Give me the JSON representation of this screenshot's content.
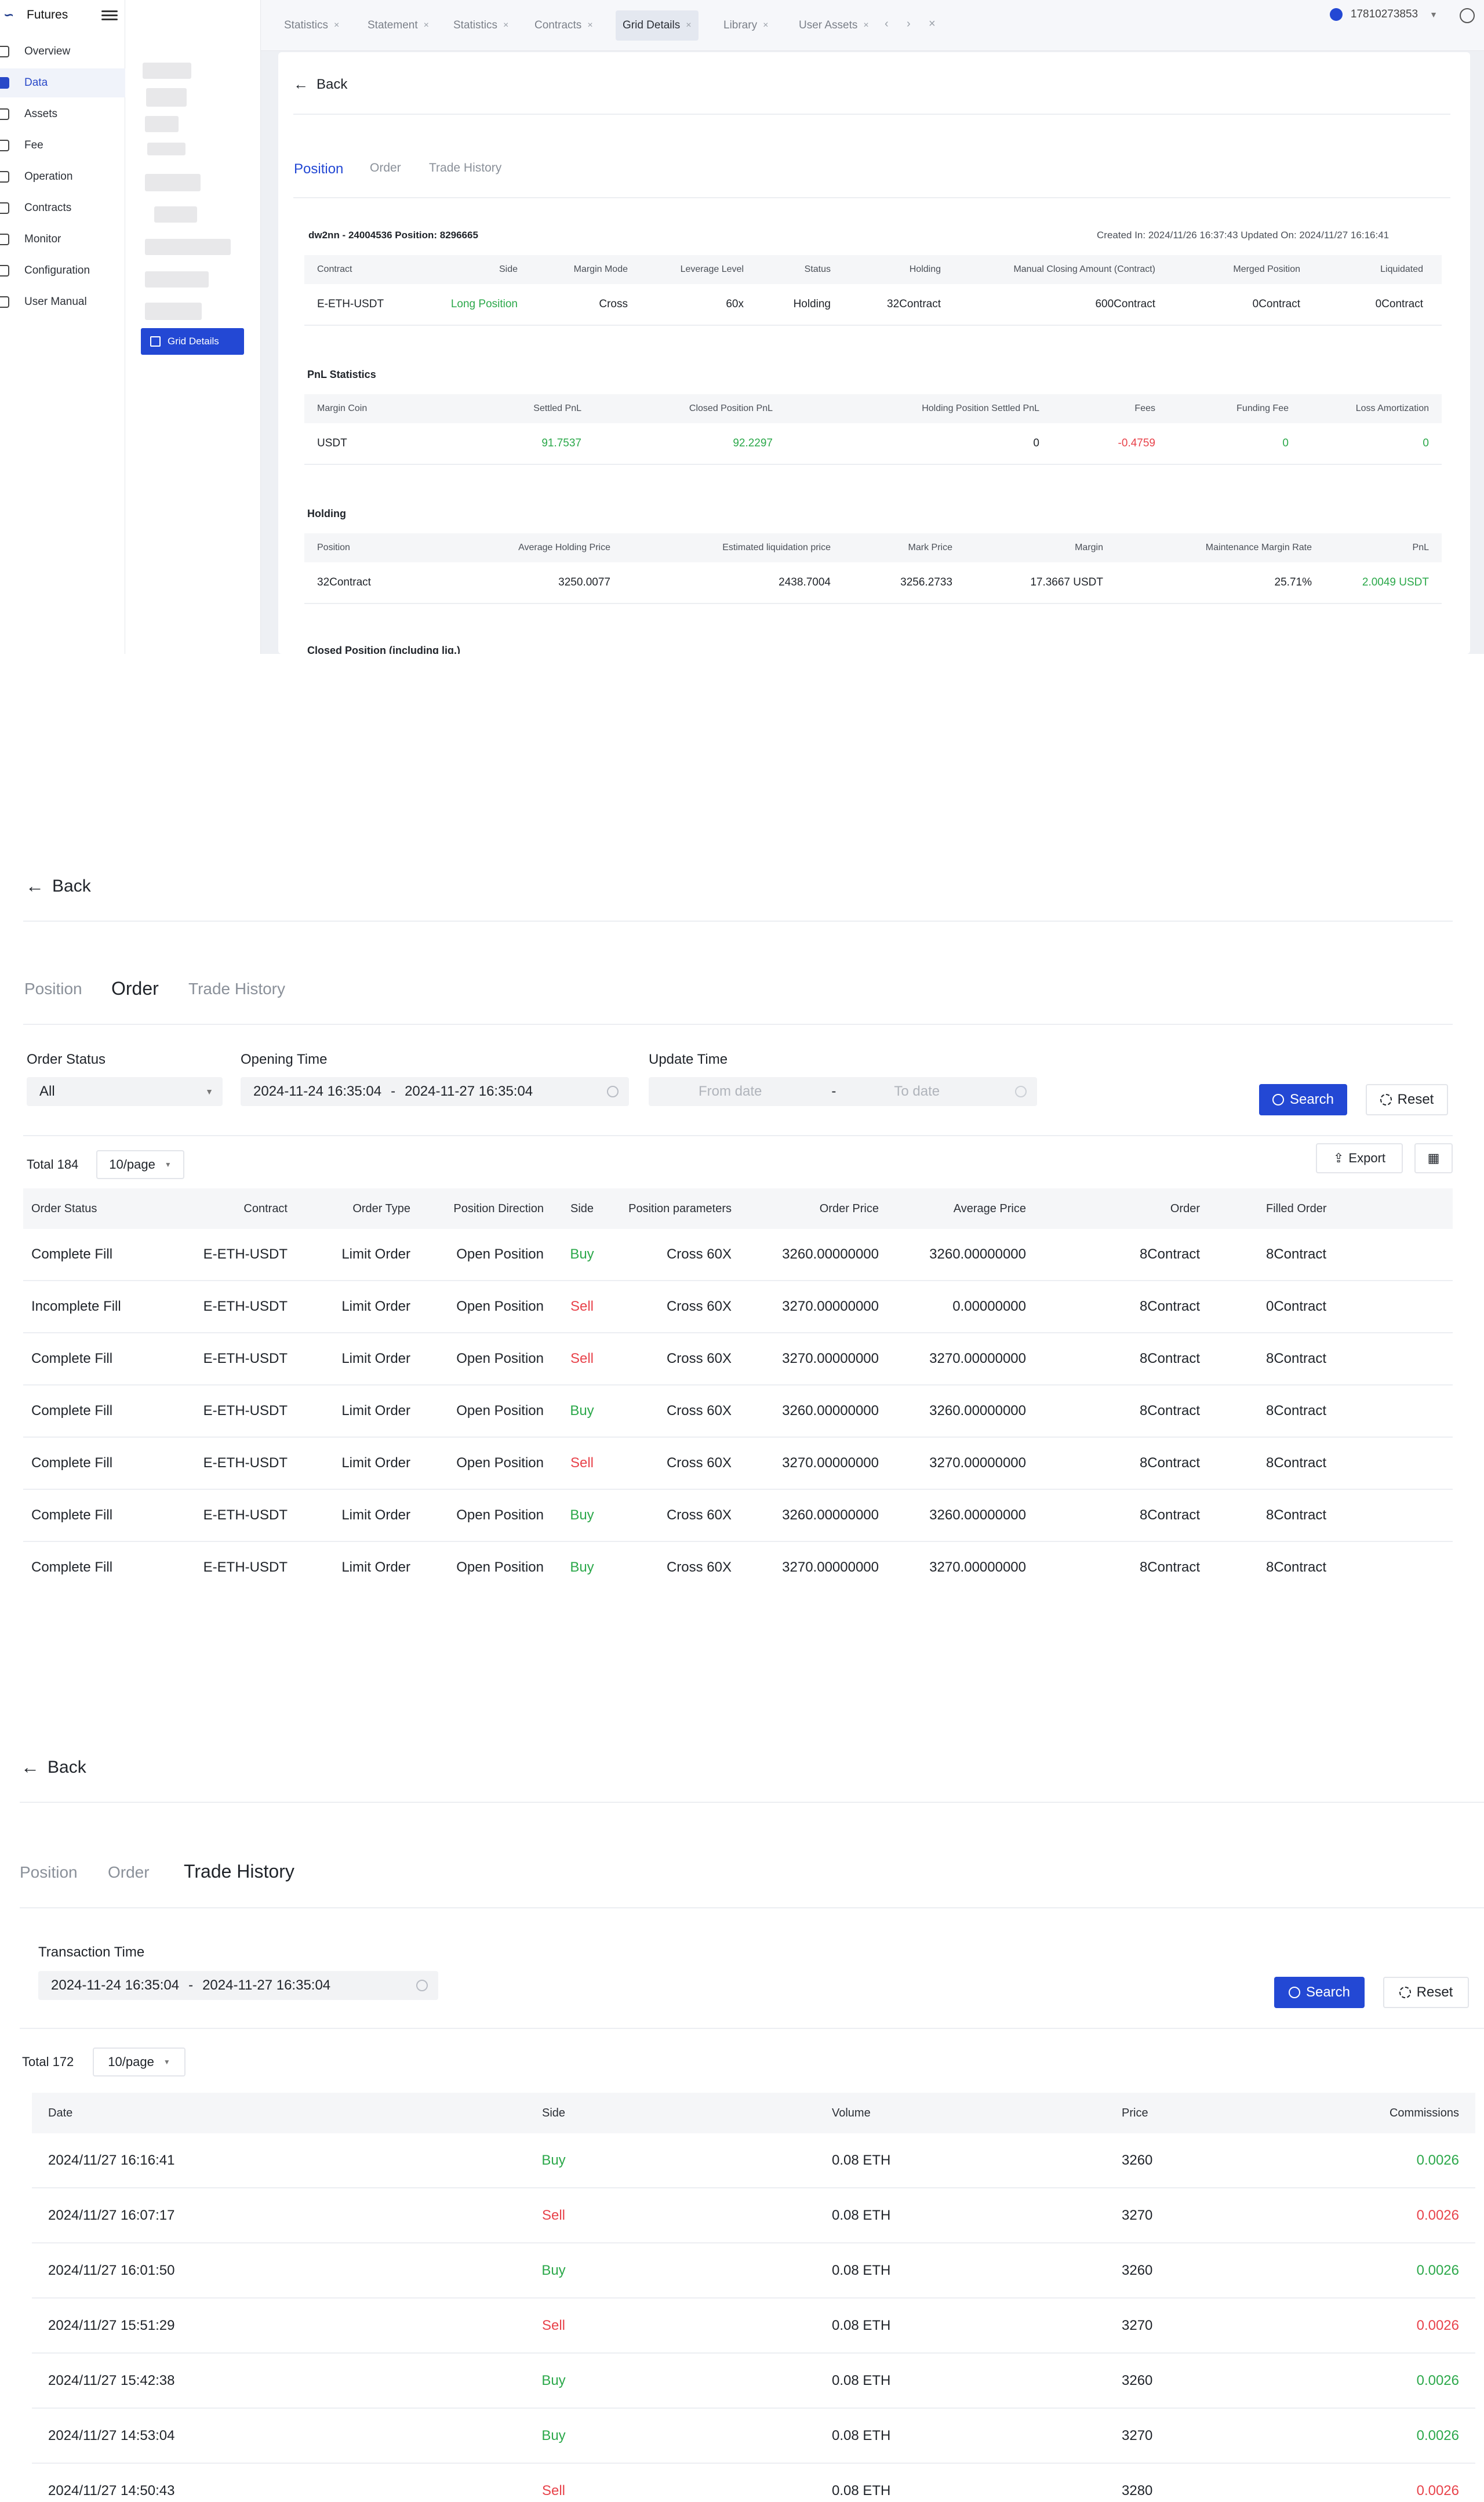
{
  "app": {
    "title": "Futures"
  },
  "sidebar": {
    "items": [
      {
        "label": "Overview",
        "icon": "list-icon"
      },
      {
        "label": "Data",
        "icon": "chart-icon"
      },
      {
        "label": "Assets",
        "icon": "coin-icon"
      },
      {
        "label": "Fee",
        "icon": "fee-icon"
      },
      {
        "label": "Operation",
        "icon": "operation-icon"
      },
      {
        "label": "Contracts",
        "icon": "contract-icon"
      },
      {
        "label": "Monitor",
        "icon": "monitor-icon"
      },
      {
        "label": "Configuration",
        "icon": "gear-icon"
      },
      {
        "label": "User Manual",
        "icon": "book-icon"
      }
    ],
    "active_index": 1
  },
  "subnav": {
    "active_label": "Grid Details"
  },
  "tabs": [
    "Statistics",
    "Statement",
    "Statistics",
    "Contracts",
    "Grid Details",
    "Library",
    "User Assets"
  ],
  "tabs_active_index": 4,
  "header": {
    "user": "17810273853"
  },
  "s1": {
    "back": "Back",
    "page_tabs": [
      "Position",
      "Order",
      "Trade History"
    ],
    "info_left": "dw2nn - 24004536 Position: 8296665",
    "info_right": "Created In: 2024/11/26 16:37:43 Updated On: 2024/11/27 16:16:41",
    "position": {
      "headers": [
        "Contract",
        "Side",
        "Margin Mode",
        "Leverage Level",
        "Status",
        "Holding",
        "Manual Closing Amount (Contract)",
        "Merged Position",
        "Liquidated"
      ],
      "row": [
        "E-ETH-USDT",
        "Long Position",
        "Cross",
        "60x",
        "Holding",
        "32Contract",
        "600Contract",
        "0Contract",
        "0Contract"
      ]
    },
    "pnl_title": "PnL Statistics",
    "pnl": {
      "headers": [
        "Margin Coin",
        "Settled PnL",
        "Closed Position PnL",
        "Holding Position Settled PnL",
        "Fees",
        "Funding Fee",
        "Loss Amortization"
      ],
      "row": [
        "USDT",
        "91.7537",
        "92.2297",
        "0",
        "-0.4759",
        "0",
        "0"
      ]
    },
    "holding_title": "Holding",
    "holding": {
      "headers": [
        "Position",
        "Average Holding Price",
        "Estimated liquidation price",
        "Mark Price",
        "Margin",
        "Maintenance Margin Rate",
        "PnL"
      ],
      "row": [
        "32Contract",
        "3250.0077",
        "2438.7004",
        "3256.2733",
        "17.3667 USDT",
        "25.71%",
        "2.0049 USDT"
      ]
    },
    "closed_title": "Closed Position (including liq.)"
  },
  "s2": {
    "back": "Back",
    "page_tabs": [
      "Position",
      "Order",
      "Trade History"
    ],
    "filters": {
      "status_label": "Order Status",
      "status_value": "All",
      "opening_label": "Opening Time",
      "opening_from": "2024-11-24 16:35:04",
      "opening_to": "2024-11-27 16:35:04",
      "update_label": "Update Time",
      "update_from_placeholder": "From date",
      "update_to_placeholder": "To date",
      "dash": "-"
    },
    "search": "Search",
    "reset": "Reset",
    "total": "Total 184",
    "page_size": "10/page",
    "export": "Export",
    "table": {
      "headers": [
        "Order Status",
        "Contract",
        "Order Type",
        "Position Direction",
        "Side",
        "Position parameters",
        "Order Price",
        "Average Price",
        "Order",
        "Filled Order"
      ],
      "rows": [
        [
          "Complete Fill",
          "E-ETH-USDT",
          "Limit Order",
          "Open Position",
          "Buy",
          "Cross 60X",
          "3260.00000000",
          "3260.00000000",
          "8Contract",
          "8Contract"
        ],
        [
          "Incomplete Fill",
          "E-ETH-USDT",
          "Limit Order",
          "Open Position",
          "Sell",
          "Cross 60X",
          "3270.00000000",
          "0.00000000",
          "8Contract",
          "0Contract"
        ],
        [
          "Complete Fill",
          "E-ETH-USDT",
          "Limit Order",
          "Open Position",
          "Sell",
          "Cross 60X",
          "3270.00000000",
          "3270.00000000",
          "8Contract",
          "8Contract"
        ],
        [
          "Complete Fill",
          "E-ETH-USDT",
          "Limit Order",
          "Open Position",
          "Buy",
          "Cross 60X",
          "3260.00000000",
          "3260.00000000",
          "8Contract",
          "8Contract"
        ],
        [
          "Complete Fill",
          "E-ETH-USDT",
          "Limit Order",
          "Open Position",
          "Sell",
          "Cross 60X",
          "3270.00000000",
          "3270.00000000",
          "8Contract",
          "8Contract"
        ],
        [
          "Complete Fill",
          "E-ETH-USDT",
          "Limit Order",
          "Open Position",
          "Buy",
          "Cross 60X",
          "3260.00000000",
          "3260.00000000",
          "8Contract",
          "8Contract"
        ],
        [
          "Complete Fill",
          "E-ETH-USDT",
          "Limit Order",
          "Open Position",
          "Buy",
          "Cross 60X",
          "3270.00000000",
          "3270.00000000",
          "8Contract",
          "8Contract"
        ]
      ]
    }
  },
  "s3": {
    "back": "Back",
    "page_tabs": [
      "Position",
      "Order",
      "Trade History"
    ],
    "filters": {
      "time_label": "Transaction Time",
      "time_from": "2024-11-24 16:35:04",
      "time_to": "2024-11-27 16:35:04",
      "dash": "-"
    },
    "search": "Search",
    "reset": "Reset",
    "total": "Total 172",
    "page_size": "10/page",
    "table": {
      "headers": [
        "Date",
        "Side",
        "Volume",
        "Price",
        "Commissions"
      ],
      "rows": [
        [
          "2024/11/27 16:16:41",
          "Buy",
          "0.08 ETH",
          "3260",
          "0.0026"
        ],
        [
          "2024/11/27 16:07:17",
          "Sell",
          "0.08 ETH",
          "3270",
          "0.0026"
        ],
        [
          "2024/11/27 16:01:50",
          "Buy",
          "0.08 ETH",
          "3260",
          "0.0026"
        ],
        [
          "2024/11/27 15:51:29",
          "Sell",
          "0.08 ETH",
          "3270",
          "0.0026"
        ],
        [
          "2024/11/27 15:42:38",
          "Buy",
          "0.08 ETH",
          "3260",
          "0.0026"
        ],
        [
          "2024/11/27 14:53:04",
          "Buy",
          "0.08 ETH",
          "3270",
          "0.0026"
        ],
        [
          "2024/11/27 14:50:43",
          "Sell",
          "0.08 ETH",
          "3280",
          "0.0026"
        ]
      ]
    }
  },
  "colors": {
    "accent": "#2348d4",
    "buy": "#2ba84a",
    "sell": "#e8434b"
  }
}
